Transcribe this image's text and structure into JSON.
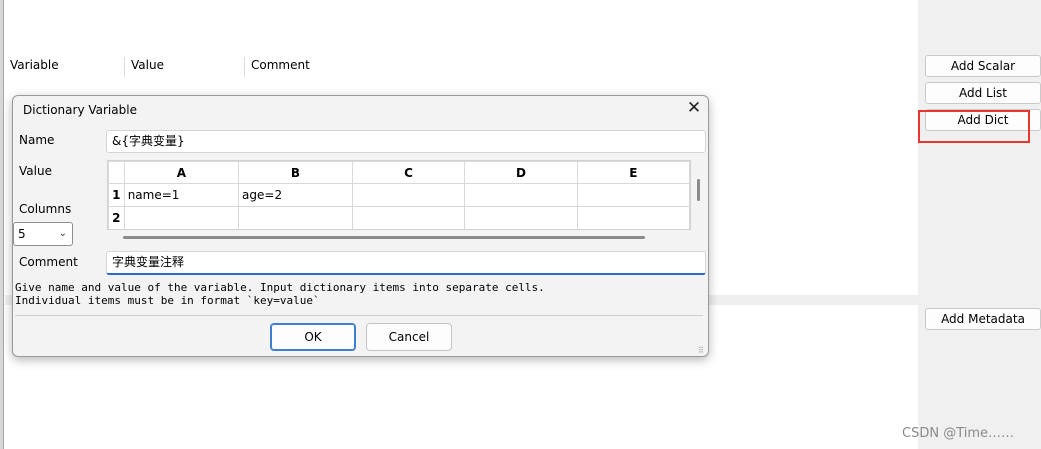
{
  "table": {
    "col_variable": "Variable",
    "col_value": "Value",
    "col_comment": "Comment"
  },
  "side_buttons": {
    "add_scalar": "Add Scalar",
    "add_list": "Add List",
    "add_dict": "Add Dict",
    "add_metadata": "Add Metadata"
  },
  "highlight_color": "#e8372c",
  "watermark": "CSDN @Time……",
  "dialog": {
    "title": "Dictionary Variable",
    "name_label": "Name",
    "name_value": "&{字典变量}",
    "value_label": "Value",
    "columns_label": "Columns",
    "columns_value": "5",
    "comment_label": "Comment",
    "comment_value": "字典变量注释",
    "grid": {
      "columns": [
        "A",
        "B",
        "C",
        "D",
        "E"
      ],
      "rows": [
        {
          "num": "1",
          "cells": [
            "name=1",
            "age=2",
            "",
            "",
            ""
          ]
        },
        {
          "num": "2",
          "cells": [
            "",
            "",
            "",
            "",
            ""
          ]
        }
      ]
    },
    "help_line1": "Give name and value of the variable. Input dictionary items into separate cells.",
    "help_line2": "Individual items must be in format `key=value`",
    "ok_label": "OK",
    "cancel_label": "Cancel"
  }
}
